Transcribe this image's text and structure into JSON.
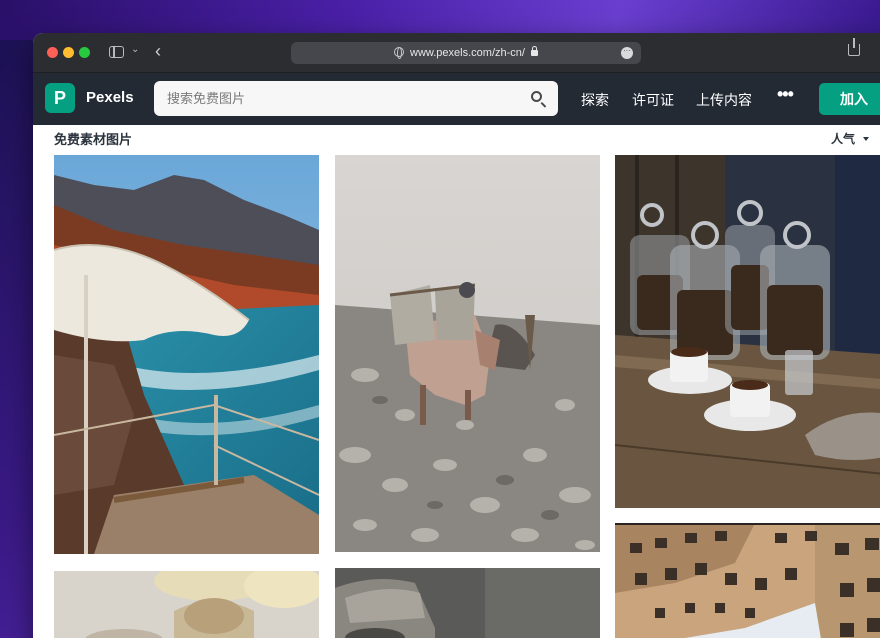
{
  "browser": {
    "url": "www.pexels.com/zh-cn/"
  },
  "header": {
    "logo_letter": "P",
    "brand": "Pexels",
    "search_placeholder": "搜索免费图片",
    "nav": {
      "explore": "探索",
      "license": "许可证",
      "upload": "上传内容",
      "more": "•••"
    },
    "join": "加入"
  },
  "main": {
    "section_title": "免费素材图片",
    "sort_label": "人气"
  },
  "colors": {
    "brand_green": "#05a081",
    "header_bg": "#232a34"
  }
}
